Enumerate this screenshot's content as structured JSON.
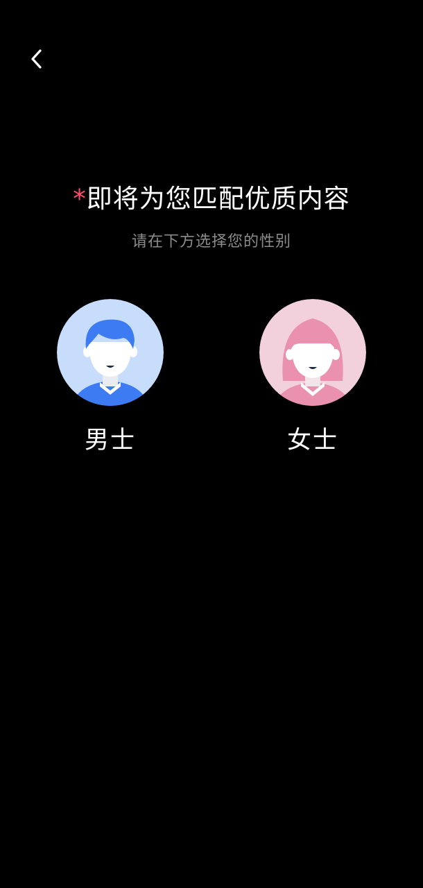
{
  "header": {
    "back_icon": "chevron-left-icon"
  },
  "title": {
    "asterisk": "*",
    "text": "即将为您匹配优质内容"
  },
  "subtitle": "请在下方选择您的性别",
  "options": [
    {
      "label": "男士",
      "icon": "male-avatar-icon",
      "bg_color": "#c7ddfb",
      "accent_color": "#3d7bf2"
    },
    {
      "label": "女士",
      "icon": "female-avatar-icon",
      "bg_color": "#f2d1dd",
      "accent_color": "#e991ae"
    }
  ],
  "colors": {
    "background": "#000000",
    "asterisk": "#ff4d6f",
    "subtitle": "#8c8c8c"
  }
}
